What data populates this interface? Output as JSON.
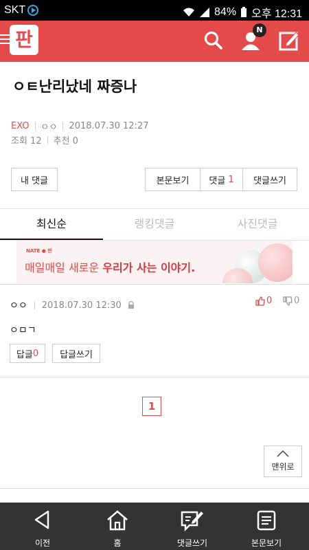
{
  "status_bar": {
    "carrier": "SKT",
    "battery": "84%",
    "time": "오후 12:31"
  },
  "header": {
    "logo_text": "판",
    "notification_badge": "N"
  },
  "post": {
    "title": "ㅇㅌ난리났네 짜증나",
    "category": "EXO",
    "author": "ㅇㅇ",
    "datetime": "2018.07.30 12:27",
    "views_label": "조회 12",
    "recommend_label": "추천 0"
  },
  "actions": {
    "my_comments": "내 댓글",
    "view_body": "본문보기",
    "comments_label": "댓글",
    "comments_count": "1",
    "write_comment": "댓글쓰기"
  },
  "tabs": [
    "최신순",
    "랭킹댓글",
    "사진댓글"
  ],
  "ad": {
    "brand": "NATE ● 판",
    "text_plain": "매일매일 새로운 ",
    "text_bold": "우리가 사는 이야기."
  },
  "comment": {
    "author": "ㅇㅇ",
    "datetime": "2018.07.30 12:30",
    "likes": "0",
    "dislikes": "0",
    "body": "ㅇㅁㄱ",
    "reply_label": "답글",
    "reply_count": "0",
    "write_reply": "답글쓰기"
  },
  "pagination": {
    "current": "1"
  },
  "top_button": "맨위로",
  "bottom_nav": [
    "이전",
    "홈",
    "댓글쓰기",
    "본문보기"
  ],
  "colors": {
    "brand_red": "#e54a4a",
    "nav_bg": "#333333"
  }
}
